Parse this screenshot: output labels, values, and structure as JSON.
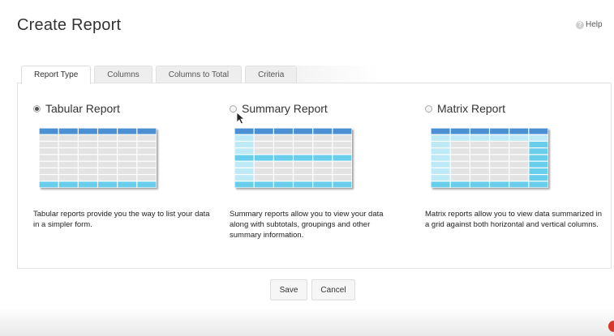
{
  "page": {
    "title": "Create Report",
    "help_label": "Help"
  },
  "tabs": [
    {
      "label": "Report Type",
      "active": true
    },
    {
      "label": "Columns",
      "active": false
    },
    {
      "label": "Columns to Total",
      "active": false
    },
    {
      "label": "Criteria",
      "active": false
    }
  ],
  "report_types": [
    {
      "label": "Tabular Report",
      "selected": true,
      "icon": "tabular-report-grid",
      "description": "Tabular reports provide you the way to list your data in a simpler form."
    },
    {
      "label": "Summary Report",
      "selected": false,
      "icon": "summary-report-grid",
      "description": "Summary reports allow you to view your data along with subtotals, groupings and other summary information."
    },
    {
      "label": "Matrix Report",
      "selected": false,
      "icon": "matrix-report-grid",
      "description": "Matrix reports allow you to view data summarized in a grid against both horizontal and vertical columns."
    }
  ],
  "buttons": {
    "save": "Save",
    "cancel": "Cancel"
  },
  "colors": {
    "header_blue": "#4a90d2",
    "highlight_cyan": "#69cdec",
    "light_cyan": "#bdeaf6",
    "cell_gray": "#e3e3e3"
  }
}
